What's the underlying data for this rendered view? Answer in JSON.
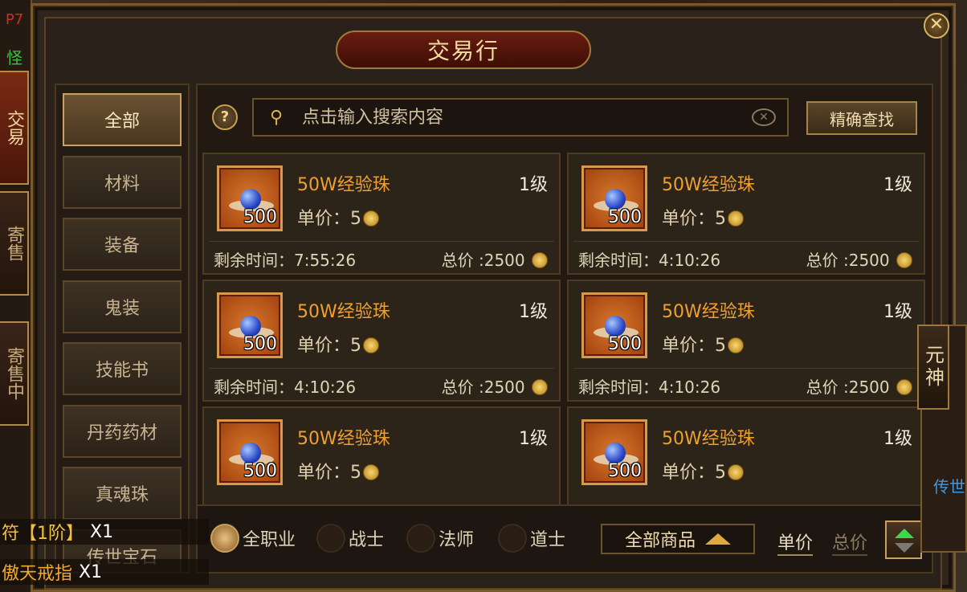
{
  "left_side": {
    "top_red": "P7",
    "top_green": "怪物",
    "tabs": [
      "交易",
      "寄售",
      "寄售中"
    ]
  },
  "title": "交易行",
  "close_label": "✕",
  "categories": [
    "全部",
    "材料",
    "装备",
    "鬼装",
    "技能书",
    "丹药药材",
    "真魂珠",
    "传世宝石"
  ],
  "search": {
    "help_label": "?",
    "icon": "search-icon",
    "placeholder": "点击输入搜索内容",
    "clear_icon": "clear-icon",
    "exact_label": "精确查找"
  },
  "items": [
    {
      "name": "50W经验珠",
      "qty": "500",
      "level": "1级",
      "price_label": "单价：5",
      "time_label": "剩余时间：7:55:26",
      "total_label": "总价 :2500"
    },
    {
      "name": "50W经验珠",
      "qty": "500",
      "level": "1级",
      "price_label": "单价：5",
      "time_label": "剩余时间：4:10:26",
      "total_label": "总价 :2500"
    },
    {
      "name": "50W经验珠",
      "qty": "500",
      "level": "1级",
      "price_label": "单价：5",
      "time_label": "剩余时间：4:10:26",
      "total_label": "总价 :2500"
    },
    {
      "name": "50W经验珠",
      "qty": "500",
      "level": "1级",
      "price_label": "单价：5",
      "time_label": "剩余时间：4:10:26",
      "total_label": "总价 :2500"
    },
    {
      "name": "50W经验珠",
      "qty": "500",
      "level": "1级",
      "price_label": "单价：5",
      "time_label": "",
      "total_label": ""
    },
    {
      "name": "50W经验珠",
      "qty": "500",
      "level": "1级",
      "price_label": "单价：5",
      "time_label": "",
      "total_label": ""
    }
  ],
  "filters": {
    "classes": [
      "全职业",
      "战士",
      "法师",
      "道士"
    ],
    "selected_class": "全职业",
    "goods_dropdown": "全部商品",
    "sort_unit": "单价",
    "sort_total": "总价"
  },
  "chat": [
    {
      "text": "符【1阶】",
      "count": "X1",
      "color": "#f0c040"
    },
    {
      "text": "傲天戒指",
      "count": "X1",
      "color": "#f0a830"
    }
  ],
  "right_side": {
    "tab": "元神",
    "label": "传世"
  },
  "colors": {
    "item_name": "#f0a030",
    "accent_gold": "#c8a060",
    "sort_up": "#3ad84a"
  }
}
